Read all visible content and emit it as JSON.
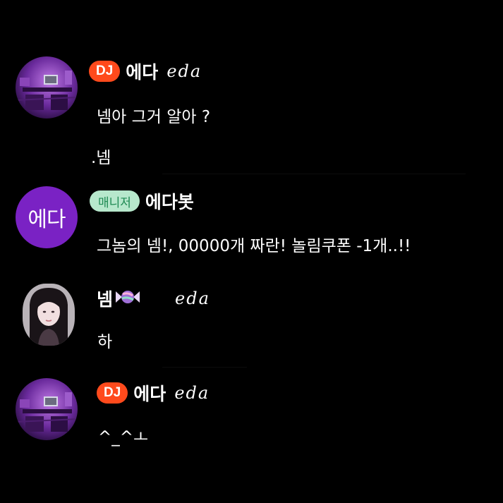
{
  "messages": [
    {
      "badge": "DJ",
      "name": "에다",
      "signature": "eda",
      "avatar_icon": "studio-room-avatar-icon",
      "lines": [
        "넴아 그거 알아 ?",
        ".넴"
      ]
    },
    {
      "badge": "매니저",
      "name": "에다봇",
      "avatar_text": "에다",
      "lines": [
        "그놈의 넴!, 00000개 짜란! 놀림쿠폰 -1개..!!"
      ]
    },
    {
      "name": "넴",
      "name_icon": "candy-icon",
      "signature": "eda",
      "avatar_icon": "profile-photo-avatar-icon",
      "lines": [
        "하"
      ]
    },
    {
      "badge": "DJ",
      "name": "에다",
      "signature": "eda",
      "avatar_icon": "studio-room-avatar-icon",
      "lines": [
        "^_^ㅗ"
      ]
    }
  ],
  "colors": {
    "background": "#000000",
    "dj_badge": "#ff4a1c",
    "manager_badge_bg": "#b7e8cc",
    "manager_badge_text": "#1f8a53",
    "bot_avatar": "#7a22c4"
  }
}
